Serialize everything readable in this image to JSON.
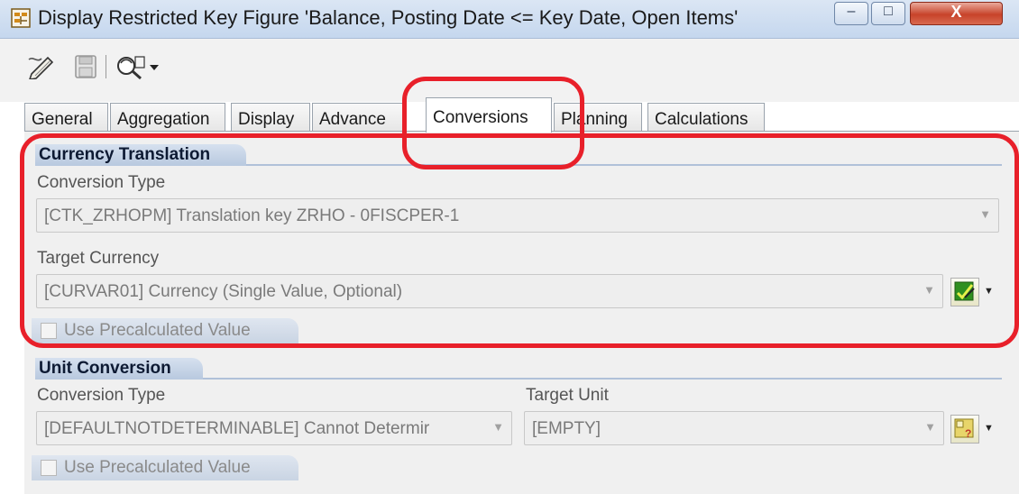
{
  "window": {
    "title": "Display Restricted Key Figure 'Balance, Posting Date <= Key Date, Open Items'",
    "min_glyph": "–",
    "max_glyph": "□",
    "close_glyph": "X"
  },
  "toolbar": {
    "icons": [
      "pencil-icon",
      "save-icon",
      "where-used-icon",
      "dropdown-arrow-icon"
    ]
  },
  "tabs": [
    {
      "label": "General"
    },
    {
      "label": "Aggregation"
    },
    {
      "label": "Display"
    },
    {
      "label": "Advance"
    },
    {
      "label": "Conversions",
      "active": true
    },
    {
      "label": "Planning"
    },
    {
      "label": "Calculations"
    }
  ],
  "currency_translation": {
    "header": "Currency Translation",
    "conversion_type_label": "Conversion Type",
    "conversion_type_value": "[CTK_ZRHOPM] Translation key ZRHO - 0FISCPER-1",
    "target_currency_label": "Target Currency",
    "target_currency_value": "[CURVAR01] Currency (Single Value, Optional)",
    "precalc_label": "Use Precalculated Value"
  },
  "unit_conversion": {
    "header": "Unit Conversion",
    "conversion_type_label": "Conversion Type",
    "conversion_type_value": "[DEFAULTNOTDETERMINABLE] Cannot Determir",
    "target_unit_label": "Target Unit",
    "target_unit_value": "[EMPTY]",
    "precalc_label": "Use Precalculated Value"
  },
  "colors": {
    "annotation": "#e8202a",
    "group_header": "#c7d5e8"
  }
}
